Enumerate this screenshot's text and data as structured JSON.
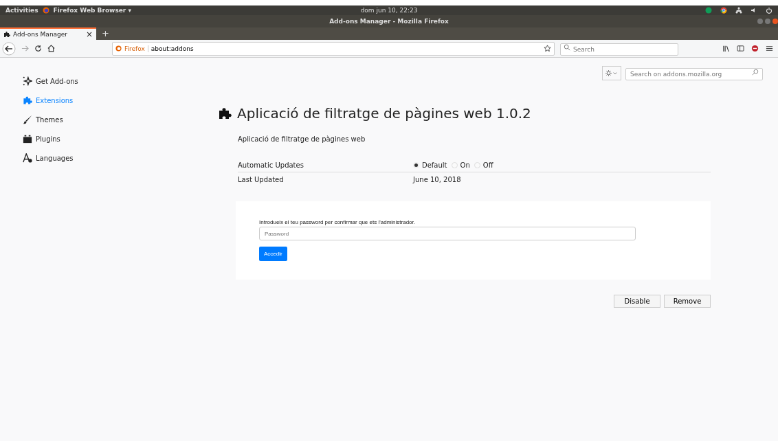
{
  "top_bar": {
    "activities": "Activities",
    "app_menu": "Firefox Web Browser ▾",
    "clock": "dom jun 10, 22:23"
  },
  "window": {
    "title": "Add-ons Manager - Mozilla Firefox"
  },
  "tabs": [
    {
      "label": "Add-ons Manager",
      "selected": true,
      "close": "×"
    }
  ],
  "new_tab": "+",
  "url_bar": {
    "identity": "Firefox",
    "url": "about:addons"
  },
  "search": {
    "placeholder": "Search"
  },
  "addons_search": {
    "placeholder": "Search on addons.mozilla.org"
  },
  "sidebar": {
    "items": [
      {
        "label": "Get Add-ons",
        "kind": "discover",
        "selected": false
      },
      {
        "label": "Extensions",
        "kind": "extension",
        "selected": true
      },
      {
        "label": "Themes",
        "kind": "theme",
        "selected": false
      },
      {
        "label": "Plugins",
        "kind": "plugin",
        "selected": false
      },
      {
        "label": "Languages",
        "kind": "language",
        "selected": false
      }
    ]
  },
  "addon": {
    "name": "Aplicació de filtratge de pàgines web",
    "version": "1.0.2",
    "description": "Aplicació de filtratge de pàgines web",
    "auto_updates": {
      "label": "Automatic Updates",
      "options": [
        {
          "label": "Default",
          "selected": true
        },
        {
          "label": "On",
          "selected": false
        },
        {
          "label": "Off",
          "selected": false
        }
      ]
    },
    "last_updated": {
      "label": "Last Updated",
      "value": "June 10, 2018"
    }
  },
  "prompt": {
    "text": "Introdueix el teu password per confirmar que ets l'administrador.",
    "placeholder": "Password",
    "button": "Accedir"
  },
  "buttons": [
    "Disable",
    "Remove"
  ]
}
